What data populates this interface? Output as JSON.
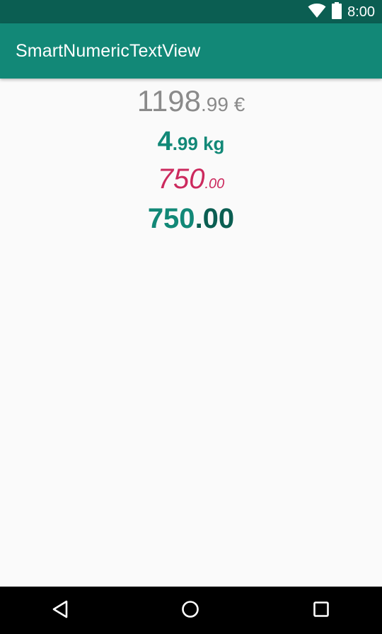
{
  "status_bar": {
    "time": "8:00",
    "icons": [
      "wifi-icon",
      "battery-icon"
    ]
  },
  "app_bar": {
    "title": "SmartNumericTextView"
  },
  "numbers": [
    {
      "integer": "1198",
      "decimal": ".99 €",
      "color": "#8a8a8a",
      "style": "regular"
    },
    {
      "integer": "4",
      "decimal": ".99 kg",
      "color": "#128877",
      "style": "bold"
    },
    {
      "integer": "750",
      "decimal": ".00",
      "color": "#cc2a5e",
      "style": "italic"
    },
    {
      "integer": "750",
      "decimal": ".00",
      "color": "#128877",
      "decimal_color": "#0b5e52",
      "style": "bold"
    }
  ],
  "nav_bar": {
    "buttons": [
      "back-icon",
      "home-icon",
      "recent-apps-icon"
    ]
  },
  "colors": {
    "primary": "#128877",
    "primary_dark": "#0b5e52",
    "accent": "#cc2a5e",
    "background": "#fafafa"
  }
}
